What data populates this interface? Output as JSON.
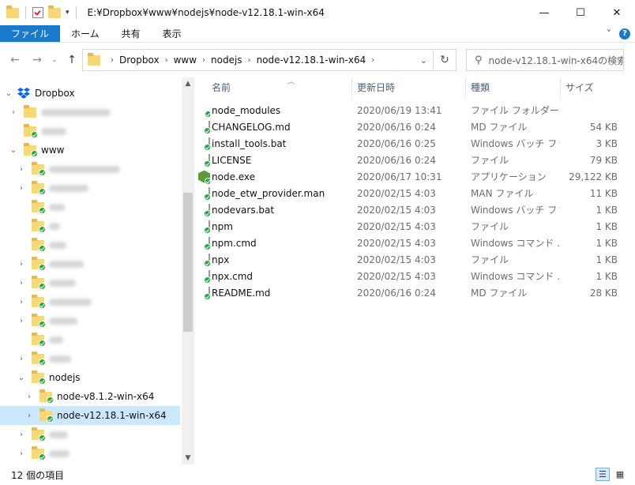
{
  "window": {
    "title": "E:¥Dropbox¥www¥nodejs¥node-v12.18.1-win-x64",
    "controls": {
      "minimize": "—",
      "maximize": "☐",
      "close": "✕"
    }
  },
  "ribbon": {
    "tabs": [
      "ファイル",
      "ホーム",
      "共有",
      "表示"
    ],
    "expand_icon": "˅",
    "help": "?"
  },
  "address": {
    "crumbs": [
      "Dropbox",
      "www",
      "nodejs",
      "node-v12.18.1-win-x64"
    ],
    "search_placeholder": "node-v12.18.1-win-x64の検索"
  },
  "sidebar": {
    "root": "Dropbox",
    "items": [
      {
        "label": "",
        "depth": 1,
        "expand": "›"
      },
      {
        "label": "",
        "depth": 1,
        "expand": ""
      },
      {
        "label": "www",
        "depth": 1,
        "expand": "⌄"
      },
      {
        "label": "",
        "depth": 2,
        "expand": "›"
      },
      {
        "label": "",
        "depth": 2,
        "expand": "›"
      },
      {
        "label": "",
        "depth": 2,
        "expand": ""
      },
      {
        "label": "",
        "depth": 2,
        "expand": ""
      },
      {
        "label": "",
        "depth": 2,
        "expand": ""
      },
      {
        "label": "",
        "depth": 2,
        "expand": "›"
      },
      {
        "label": "",
        "depth": 2,
        "expand": "›"
      },
      {
        "label": "",
        "depth": 2,
        "expand": "›"
      },
      {
        "label": "",
        "depth": 2,
        "expand": "›"
      },
      {
        "label": "",
        "depth": 2,
        "expand": ""
      },
      {
        "label": "",
        "depth": 2,
        "expand": "›"
      },
      {
        "label": "nodejs",
        "depth": 2,
        "expand": "⌄"
      },
      {
        "label": "node-v8.1.2-win-x64",
        "depth": 3,
        "expand": "›"
      },
      {
        "label": "node-v12.18.1-win-x64",
        "depth": 3,
        "expand": "›",
        "selected": true
      },
      {
        "label": "",
        "depth": 2,
        "expand": "›"
      },
      {
        "label": "",
        "depth": 2,
        "expand": "›"
      }
    ]
  },
  "columns": {
    "name": "名前",
    "date": "更新日時",
    "type": "種類",
    "size": "サイズ"
  },
  "files": [
    {
      "name": "node_modules",
      "date": "2020/06/19 13:41",
      "type": "ファイル フォルダー",
      "size": "",
      "icon": "folder-icon"
    },
    {
      "name": "CHANGELOG.md",
      "date": "2020/06/16 0:24",
      "type": "MD ファイル",
      "size": "54 KB",
      "icon": "document-icon"
    },
    {
      "name": "install_tools.bat",
      "date": "2020/06/16 0:25",
      "type": "Windows バッチ ファ...",
      "size": "3 KB",
      "icon": "batch-file-icon"
    },
    {
      "name": "LICENSE",
      "date": "2020/06/16 0:24",
      "type": "ファイル",
      "size": "79 KB",
      "icon": "document-icon"
    },
    {
      "name": "node.exe",
      "date": "2020/06/17 10:31",
      "type": "アプリケーション",
      "size": "29,122 KB",
      "icon": "nodejs-app-icon"
    },
    {
      "name": "node_etw_provider.man",
      "date": "2020/02/15 4:03",
      "type": "MAN ファイル",
      "size": "11 KB",
      "icon": "document-icon"
    },
    {
      "name": "nodevars.bat",
      "date": "2020/02/15 4:03",
      "type": "Windows バッチ ファ...",
      "size": "1 KB",
      "icon": "batch-file-icon"
    },
    {
      "name": "npm",
      "date": "2020/02/15 4:03",
      "type": "ファイル",
      "size": "1 KB",
      "icon": "document-icon"
    },
    {
      "name": "npm.cmd",
      "date": "2020/02/15 4:03",
      "type": "Windows コマンド ...",
      "size": "1 KB",
      "icon": "batch-file-icon"
    },
    {
      "name": "npx",
      "date": "2020/02/15 4:03",
      "type": "ファイル",
      "size": "1 KB",
      "icon": "document-icon"
    },
    {
      "name": "npx.cmd",
      "date": "2020/02/15 4:03",
      "type": "Windows コマンド ...",
      "size": "1 KB",
      "icon": "batch-file-icon"
    },
    {
      "name": "README.md",
      "date": "2020/06/16 0:24",
      "type": "MD ファイル",
      "size": "28 KB",
      "icon": "document-icon"
    }
  ],
  "status": {
    "count": "12 個の項目"
  },
  "colors": {
    "accent": "#1979ca",
    "selection": "#cce8ff",
    "folder": "#f8d775",
    "sync_ok": "#28a745"
  }
}
